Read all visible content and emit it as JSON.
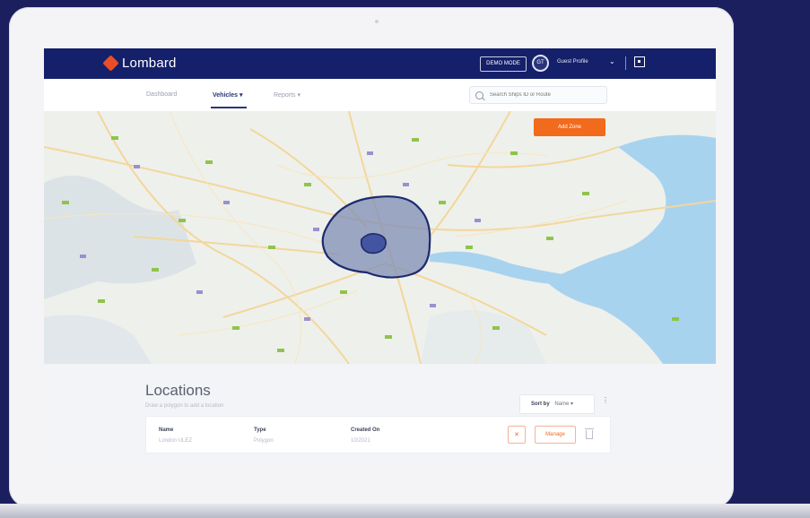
{
  "app": {
    "brand": "Lombard",
    "header_button": "DEMO MODE",
    "avatar_initials": "GT",
    "user_name": "Guest Profile"
  },
  "nav": {
    "tabs": [
      {
        "label": "Dashboard",
        "active": false
      },
      {
        "label": "Vehicles ▾",
        "active": true
      },
      {
        "label": "Reports ▾",
        "active": false
      }
    ],
    "search_placeholder": "Search Ships ID or Route"
  },
  "map": {
    "action_button": "Add Zone",
    "colors": {
      "zone_fill": "#7f8eb6",
      "zone_stroke": "#1c2a6f",
      "water": "#a8d3ef",
      "accent": "#f26a1b"
    }
  },
  "locations": {
    "title": "Locations",
    "subtitle": "Draw a polygon to add a location",
    "sort_label": "Sort by",
    "sort_value": "Name ▾",
    "sort_extra": "⋮",
    "columns": [
      "Name",
      "Type",
      "Created On"
    ],
    "row": [
      "London ULEZ",
      "Polygon",
      "10/2021"
    ],
    "delete_icon": "✕",
    "manage_button": "Manage"
  }
}
